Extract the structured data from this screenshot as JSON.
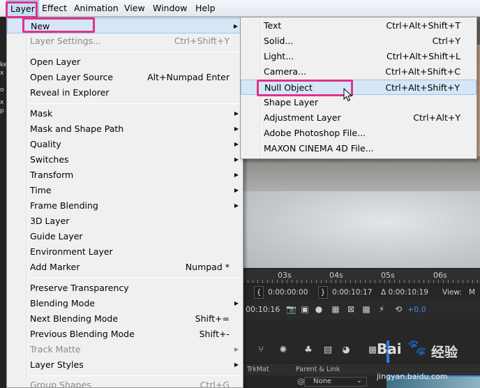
{
  "menubar": {
    "items": [
      "Layer",
      "Effect",
      "Animation",
      "View",
      "Window",
      "Help"
    ]
  },
  "layer_menu": {
    "items": [
      {
        "label": "New",
        "submenu": true,
        "highlighted": true
      },
      {
        "label": "Layer Settings...",
        "shortcut": "Ctrl+Shift+Y",
        "disabled": true
      },
      {
        "label": "Open Layer"
      },
      {
        "label": "Open Layer Source",
        "shortcut": "Alt+Numpad Enter"
      },
      {
        "label": "Reveal in Explorer"
      },
      {
        "label": "Mask",
        "submenu": true
      },
      {
        "label": "Mask and Shape Path",
        "submenu": true
      },
      {
        "label": "Quality",
        "submenu": true
      },
      {
        "label": "Switches",
        "submenu": true
      },
      {
        "label": "Transform",
        "submenu": true
      },
      {
        "label": "Time",
        "submenu": true
      },
      {
        "label": "Frame Blending",
        "submenu": true
      },
      {
        "label": "3D Layer"
      },
      {
        "label": "Guide Layer"
      },
      {
        "label": "Environment Layer"
      },
      {
        "label": "Add Marker",
        "shortcut": "Numpad *"
      },
      {
        "label": "Preserve Transparency"
      },
      {
        "label": "Blending Mode",
        "submenu": true
      },
      {
        "label": "Next Blending Mode",
        "shortcut": "Shift+="
      },
      {
        "label": "Previous Blending Mode",
        "shortcut": "Shift+-"
      },
      {
        "label": "Track Matte",
        "submenu": true,
        "disabled": true
      },
      {
        "label": "Layer Styles",
        "submenu": true
      },
      {
        "label": "Group Shapes",
        "shortcut": "Ctrl+G",
        "disabled": true
      }
    ]
  },
  "new_submenu": {
    "items": [
      {
        "label": "Text",
        "shortcut": "Ctrl+Alt+Shift+T"
      },
      {
        "label": "Solid...",
        "shortcut": "Ctrl+Y"
      },
      {
        "label": "Light...",
        "shortcut": "Ctrl+Alt+Shift+L"
      },
      {
        "label": "Camera...",
        "shortcut": "Ctrl+Alt+Shift+C"
      },
      {
        "label": "Null Object",
        "shortcut": "Ctrl+Alt+Shift+Y",
        "highlighted": true
      },
      {
        "label": "Shape Layer"
      },
      {
        "label": "Adjustment Layer",
        "shortcut": "Ctrl+Alt+Y"
      },
      {
        "label": "Adobe Photoshop File..."
      },
      {
        "label": "MAXON CINEMA 4D File..."
      }
    ]
  },
  "timeline": {
    "ruler_ticks": [
      "03s",
      "04s",
      "05s",
      "06s"
    ],
    "in_point": "0:00:00:00",
    "out_point": "0:00:10:17",
    "duration": "Δ 0:00:10:19",
    "view_label": "View:",
    "view_value": "M",
    "current_time": "00:10:16",
    "exposure": "+0.0",
    "column_trkmat": "TrkMat",
    "column_parent": "Parent & Link",
    "parent_value": "None"
  },
  "left_panel_fragments": [
    "ke",
    "x",
    "o",
    "x",
    "p"
  ],
  "watermark": {
    "brand": "Bai",
    "brand_cn": "经验",
    "url": "jingyan.baidu.com"
  },
  "colors": {
    "highlight_box": "#e0318c",
    "menu_bg": "#f0f0f0",
    "hover_bg": "#d5e6f7",
    "accent_blue": "#3d8ee8"
  }
}
